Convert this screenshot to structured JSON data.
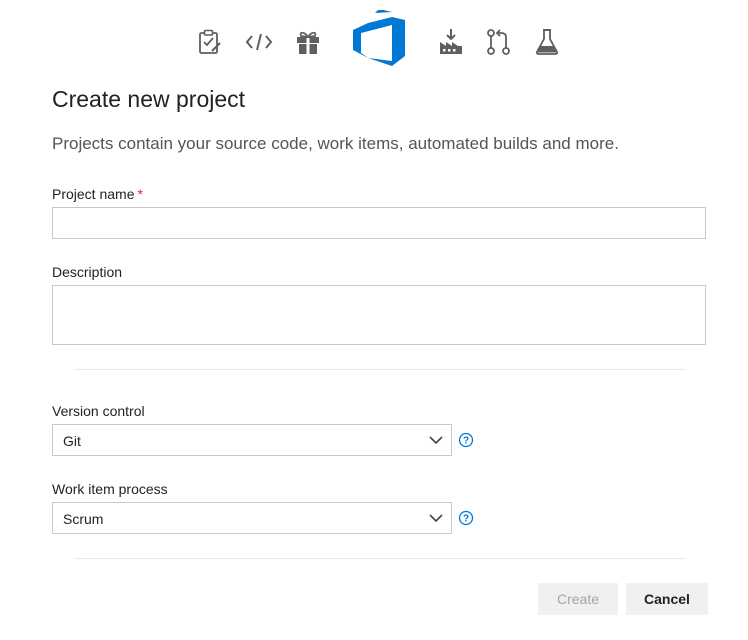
{
  "header": {
    "icons": [
      "boards-icon",
      "repos-icon",
      "artifacts-icon",
      "azure-devops-logo",
      "build-icon",
      "pull-request-icon",
      "test-plans-icon"
    ]
  },
  "page": {
    "title": "Create new project",
    "subtitle": "Projects contain your source code, work items, automated builds and more."
  },
  "form": {
    "project_name_label": "Project name",
    "required_marker": "*",
    "project_name_value": "",
    "description_label": "Description",
    "description_value": "",
    "version_control_label": "Version control",
    "version_control_value": "Git",
    "work_item_process_label": "Work item process",
    "work_item_process_value": "Scrum",
    "help_glyph": "?"
  },
  "actions": {
    "create_label": "Create",
    "cancel_label": "Cancel"
  },
  "colors": {
    "accent": "#0078d4",
    "icon_gray": "#5f5f5f",
    "required": "#d13438"
  }
}
